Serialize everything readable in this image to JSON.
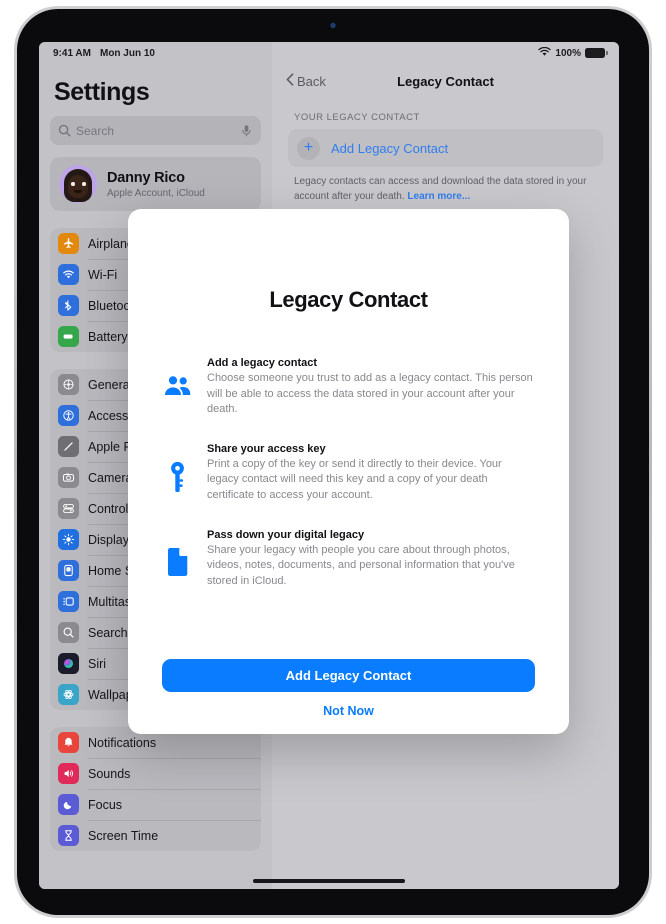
{
  "status_bar": {
    "time": "9:41 AM",
    "date": "Mon Jun 10",
    "wifi_icon": "wifi-icon",
    "battery_percent": "100%",
    "battery_icon": "battery-full-icon"
  },
  "sidebar": {
    "title": "Settings",
    "search": {
      "placeholder": "Search",
      "value": "",
      "icon": "search-icon",
      "mic_icon": "microphone-icon"
    },
    "account": {
      "name": "Danny Rico",
      "subtitle": "Apple Account, iCloud",
      "avatar_icon": "memoji-avatar"
    },
    "groups": [
      {
        "items": [
          {
            "label": "Airplane Mode",
            "icon": "airplane-icon",
            "color": "#e2890d"
          },
          {
            "label": "Wi-Fi",
            "icon": "wifi-icon",
            "color": "#2f6fdb"
          },
          {
            "label": "Bluetooth",
            "icon": "bluetooth-icon",
            "color": "#2f6fdb"
          },
          {
            "label": "Battery",
            "icon": "battery-icon",
            "color": "#35a64a"
          }
        ]
      },
      {
        "items": [
          {
            "label": "General",
            "icon": "gear-icon",
            "color": "#8a8a8f"
          },
          {
            "label": "Accessibility",
            "icon": "accessibility-icon",
            "color": "#2f6fdb"
          },
          {
            "label": "Apple Pencil",
            "icon": "pencil-icon",
            "color": "#6e6e73"
          },
          {
            "label": "Camera",
            "icon": "camera-icon",
            "color": "#8a8a8f"
          },
          {
            "label": "Control Center",
            "icon": "control-center-icon",
            "color": "#8a8a8f"
          },
          {
            "label": "Display & Brightness",
            "icon": "brightness-icon",
            "color": "#1f6fe0"
          },
          {
            "label": "Home Screen & App Library",
            "icon": "home-screen-icon",
            "color": "#2f6fdb"
          },
          {
            "label": "Multitasking & Gestures",
            "icon": "multitasking-icon",
            "color": "#2f6fdb"
          },
          {
            "label": "Search",
            "icon": "search-icon",
            "color": "#8a8a8f"
          },
          {
            "label": "Siri",
            "icon": "siri-icon",
            "color": "#1b1b2b"
          },
          {
            "label": "Wallpaper",
            "icon": "wallpaper-icon",
            "color": "#3aa5c9"
          }
        ]
      },
      {
        "items": [
          {
            "label": "Notifications",
            "icon": "bell-icon",
            "color": "#e8453c"
          },
          {
            "label": "Sounds",
            "icon": "speaker-icon",
            "color": "#e02a5a"
          },
          {
            "label": "Focus",
            "icon": "moon-icon",
            "color": "#5b5bd6"
          },
          {
            "label": "Screen Time",
            "icon": "hourglass-icon",
            "color": "#5b5bd6"
          }
        ]
      }
    ]
  },
  "detail": {
    "back_label": "Back",
    "back_icon": "chevron-left-icon",
    "nav_title": "Legacy Contact",
    "section_header": "YOUR LEGACY CONTACT",
    "add_contact_label": "Add Legacy Contact",
    "plus_icon": "plus-icon",
    "footnote_text": "Legacy contacts can access and download the data stored in your account after your death. ",
    "footnote_link": "Learn more..."
  },
  "modal": {
    "title": "Legacy Contact",
    "features": [
      {
        "icon": "two-people-icon",
        "title": "Add a legacy contact",
        "desc": "Choose someone you trust to add as a legacy contact. This person will be able to access the data stored in your account after your death."
      },
      {
        "icon": "key-icon",
        "title": "Share your access key",
        "desc": "Print a copy of the key or send it directly to their device. Your legacy contact will need this key and a copy of your death certificate to access your account."
      },
      {
        "icon": "document-icon",
        "title": "Pass down your digital legacy",
        "desc": "Share your legacy with people you care about through photos, videos, notes, documents, and personal information that you've stored in iCloud."
      }
    ],
    "primary_button": "Add Legacy Contact",
    "secondary_button": "Not Now"
  },
  "colors": {
    "accent": "#0a7cff",
    "link": "#2f7df0",
    "sidebar_bg": "#c3c3c7",
    "detail_bg": "#c9c9cd"
  }
}
